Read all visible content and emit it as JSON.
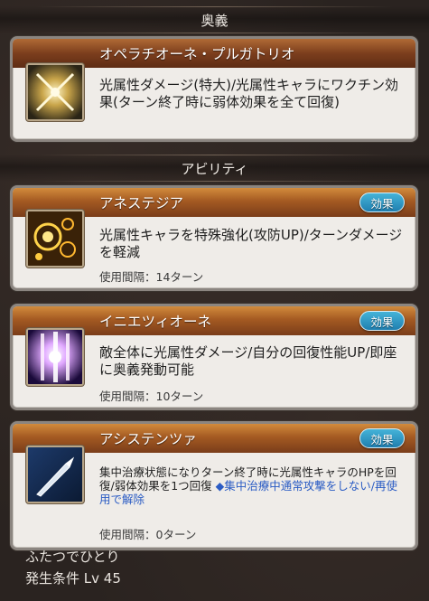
{
  "ougi_header": "奥義",
  "ougi": {
    "name": "オペラチオーネ・プルガトリオ",
    "icon": "crossed-swords-icon",
    "description": "光属性ダメージ(特大)/光属性キャラにワクチン効果(ターン終了時に弱体効果を全て回復)"
  },
  "ability_header": "アビリティ",
  "abilities": [
    {
      "name": "アネステジア",
      "badge": "効果",
      "icon": "gold-rings-icon",
      "description": "光属性キャラを特殊強化(攻防UP)/ターンダメージを軽減",
      "cooldown": "使用間隔：14ターン"
    },
    {
      "name": "イニエツィオーネ",
      "badge": "効果",
      "icon": "light-pillars-icon",
      "description": "敵全体に光属性ダメージ/自分の回復性能UP/即座に奥義発動可能",
      "cooldown": "使用間隔：10ターン"
    },
    {
      "name": "アシステンツァ",
      "badge": "効果",
      "icon": "scalpel-icon",
      "description_part1": "集中治療状態になりターン終了時に光属性キャラのHPを回復/弱体効果を1つ回復",
      "description_link": "◆集中治療中通常攻撃をしない/再使用で解除",
      "cooldown": "使用間隔：0ターン"
    }
  ],
  "footer": {
    "support_name": "ふたつでひとり",
    "condition": "発生条件 Lv 45"
  }
}
